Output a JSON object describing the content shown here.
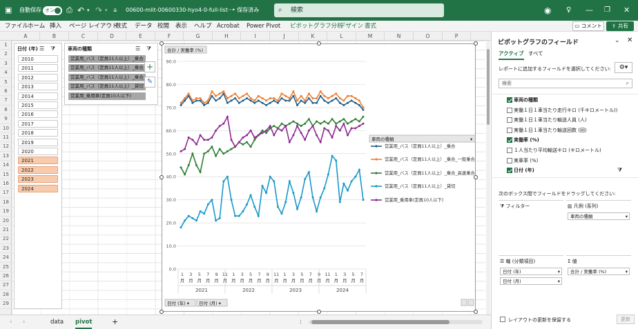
{
  "titlebar": {
    "autosave_label": "自動保存",
    "autosave_state": "オン",
    "filename": "00600-mlit-00600330-hyo4-0-full-list···",
    "save_status": "• 保存済み",
    "search_placeholder": "検索"
  },
  "menu": {
    "items": [
      "ファイル",
      "ホーム",
      "挿入",
      "ページ レイアウト",
      "数式",
      "データ",
      "校閲",
      "表示",
      "ヘルプ",
      "Acrobat",
      "Power Pivot",
      "ピボットグラフ分析",
      "デザイン",
      "書式"
    ],
    "comment_label": "コメント",
    "share_label": "共有"
  },
  "columns": [
    "A",
    "B",
    "C",
    "D",
    "E",
    "F",
    "G",
    "H",
    "I",
    "J",
    "K",
    "L",
    "M",
    "N",
    "O",
    "P"
  ],
  "rows": [
    "1",
    "2",
    "3",
    "4",
    "5",
    "6",
    "7",
    "8",
    "9",
    "10",
    "11",
    "12",
    "13",
    "14",
    "15",
    "16",
    "17",
    "18",
    "19",
    "20",
    "21",
    "22",
    "23",
    "24",
    "25",
    "26",
    "27",
    "28",
    "29"
  ],
  "slicer_year": {
    "header": "日付 (年)",
    "items": [
      {
        "label": "2010",
        "selected": false
      },
      {
        "label": "2011",
        "selected": false
      },
      {
        "label": "2012",
        "selected": false
      },
      {
        "label": "2013",
        "selected": false
      },
      {
        "label": "2014",
        "selected": false
      },
      {
        "label": "2015",
        "selected": false
      },
      {
        "label": "2016",
        "selected": false
      },
      {
        "label": "2017",
        "selected": false
      },
      {
        "label": "2018",
        "selected": false
      },
      {
        "label": "2019",
        "selected": false
      },
      {
        "label": "2020",
        "selected": false
      },
      {
        "label": "2021",
        "selected": true
      },
      {
        "label": "2022",
        "selected": true
      },
      {
        "label": "2023",
        "selected": true
      },
      {
        "label": "2024",
        "selected": true
      }
    ]
  },
  "slicer_car": {
    "header": "車両の種類",
    "items": [
      "営業用_バス（定員11人以上）_乗合",
      "営業用_バス（定員11人以上）_乗合_一般...",
      "営業用_バス（定員11人以上）_乗合_高速...",
      "営業用_バス（定員11人以上）_貸切",
      "営業用_乗用車(定員10人以下)"
    ]
  },
  "chart_data": {
    "type": "line",
    "value_field_label": "合計 / 実働率 (%)",
    "ylim": [
      0,
      90
    ],
    "yticks": [
      "0.0",
      "10.0",
      "20.0",
      "30.0",
      "40.0",
      "50.0",
      "60.0",
      "70.0",
      "80.0",
      "90.0"
    ],
    "month_labels": [
      "1",
      "3",
      "5",
      "7",
      "9",
      "11",
      "1",
      "3",
      "5",
      "7",
      "9",
      "11",
      "1",
      "3",
      "5",
      "7",
      "9",
      "11",
      "1",
      "3",
      "5",
      "7"
    ],
    "month_suffix": "月",
    "year_labels": [
      "2021",
      "2022",
      "2023",
      "2024"
    ],
    "legend_title": "車両の種類",
    "axis_buttons": [
      "日付 (年)",
      "日付 (月)"
    ],
    "series": [
      {
        "name": "営業用_バス（定員11人以上）_乗合",
        "color": "#1f5f8b",
        "values": [
          71,
          73,
          75,
          72,
          73,
          73,
          71,
          72,
          75,
          73,
          74,
          76,
          72,
          73,
          74,
          72,
          73,
          74,
          73,
          72,
          73,
          72,
          71,
          72,
          73,
          72,
          74,
          73,
          73,
          75,
          71,
          73,
          72,
          74,
          72,
          72,
          75,
          73,
          72,
          73,
          74,
          72,
          71,
          72,
          73,
          72,
          71,
          69
        ]
      },
      {
        "name": "営業用_バス（定員11人以上）_乗合_一般乗合",
        "color": "#ed7d31",
        "values": [
          72,
          74,
          76,
          73,
          74,
          74,
          72,
          73,
          77,
          75,
          76,
          77,
          74,
          75,
          76,
          74,
          75,
          76,
          74,
          73,
          75,
          74,
          73,
          74,
          74,
          73,
          76,
          75,
          74,
          77,
          73,
          75,
          73,
          76,
          74,
          74,
          77,
          75,
          74,
          75,
          76,
          74,
          73,
          75,
          75,
          74,
          73,
          70
        ]
      },
      {
        "name": "営業用_バス（定員11人以上）_乗合_高速乗合",
        "color": "#2e7d32",
        "values": [
          44,
          41,
          45,
          50,
          45,
          42,
          50,
          51,
          53,
          49,
          52,
          50,
          51,
          52,
          53,
          55,
          54,
          55,
          53,
          56,
          58,
          60,
          59,
          61,
          62,
          61,
          63,
          62,
          63,
          64,
          63,
          62,
          63,
          65,
          62,
          64,
          63,
          64,
          63,
          65,
          63,
          64,
          65,
          63,
          64,
          65,
          64,
          66
        ]
      },
      {
        "name": "営業用_バス（定員11人以上）_貸切",
        "color": "#1797c9",
        "values": [
          18,
          21,
          23,
          22,
          21,
          25,
          24,
          28,
          30,
          21,
          22,
          38,
          40,
          30,
          23,
          23,
          25,
          28,
          32,
          27,
          23,
          36,
          33,
          40,
          38,
          27,
          24,
          29,
          38,
          33,
          26,
          31,
          39,
          42,
          31,
          25,
          31,
          35,
          41,
          49,
          47,
          29,
          37,
          34,
          38,
          40,
          43,
          30
        ]
      },
      {
        "name": "営業用_乗用車(定員10人以下)",
        "color": "#8b2a8f",
        "values": [
          51,
          52,
          57,
          56,
          54,
          58,
          56,
          56,
          57,
          60,
          62,
          63,
          66,
          56,
          53,
          55,
          57,
          58,
          60,
          57,
          58,
          59,
          60,
          62,
          58,
          61,
          60,
          62,
          55,
          58,
          62,
          59,
          56,
          60,
          62,
          58,
          55,
          61,
          60,
          57,
          62,
          60,
          63,
          58,
          61,
          61,
          62,
          63
        ]
      }
    ]
  },
  "pane": {
    "title": "ピボットグラフのフィールド",
    "tabs": [
      "アクティブ",
      "すべて"
    ],
    "instruction": "レポートに追加するフィールドを選択してください:",
    "search_placeholder": "検索",
    "fields": [
      {
        "label": "車両の種類",
        "checked": true,
        "bold": true
      },
      {
        "label": "実働１日１車当たり走行キロ (千キロメートル))",
        "checked": false,
        "bold": false
      },
      {
        "label": "実働１日１車当たり輸送人員 (人)",
        "checked": false,
        "bold": false
      },
      {
        "label": "実働１日１車当たり輸送回数 (回)",
        "checked": false,
        "bold": false
      },
      {
        "label": "実働率 (%)",
        "checked": true,
        "bold": true
      },
      {
        "label": "１人当たり平均輸送キロ (キロメートル)",
        "checked": false,
        "bold": false
      },
      {
        "label": "実車率 (%)",
        "checked": false,
        "bold": false
      },
      {
        "label": "日付 (年)",
        "checked": true,
        "bold": true
      }
    ],
    "drag_label": "次のボックス間でフィールドをドラッグしてください:",
    "areas": {
      "filter": "フィルター",
      "legend": "凡例 (系列)",
      "legend_items": [
        "車両の種類"
      ],
      "axis": "軸 (分類項目)",
      "axis_items": [
        "日付 (年)",
        "日付 (月)"
      ],
      "values": "値",
      "value_items": [
        "合計 / 実働率 (%)"
      ]
    },
    "defer_label": "レイアウトの更新を保留する",
    "update_label": "更新"
  },
  "sheets": [
    "data",
    "pivot"
  ],
  "active_sheet": "pivot"
}
